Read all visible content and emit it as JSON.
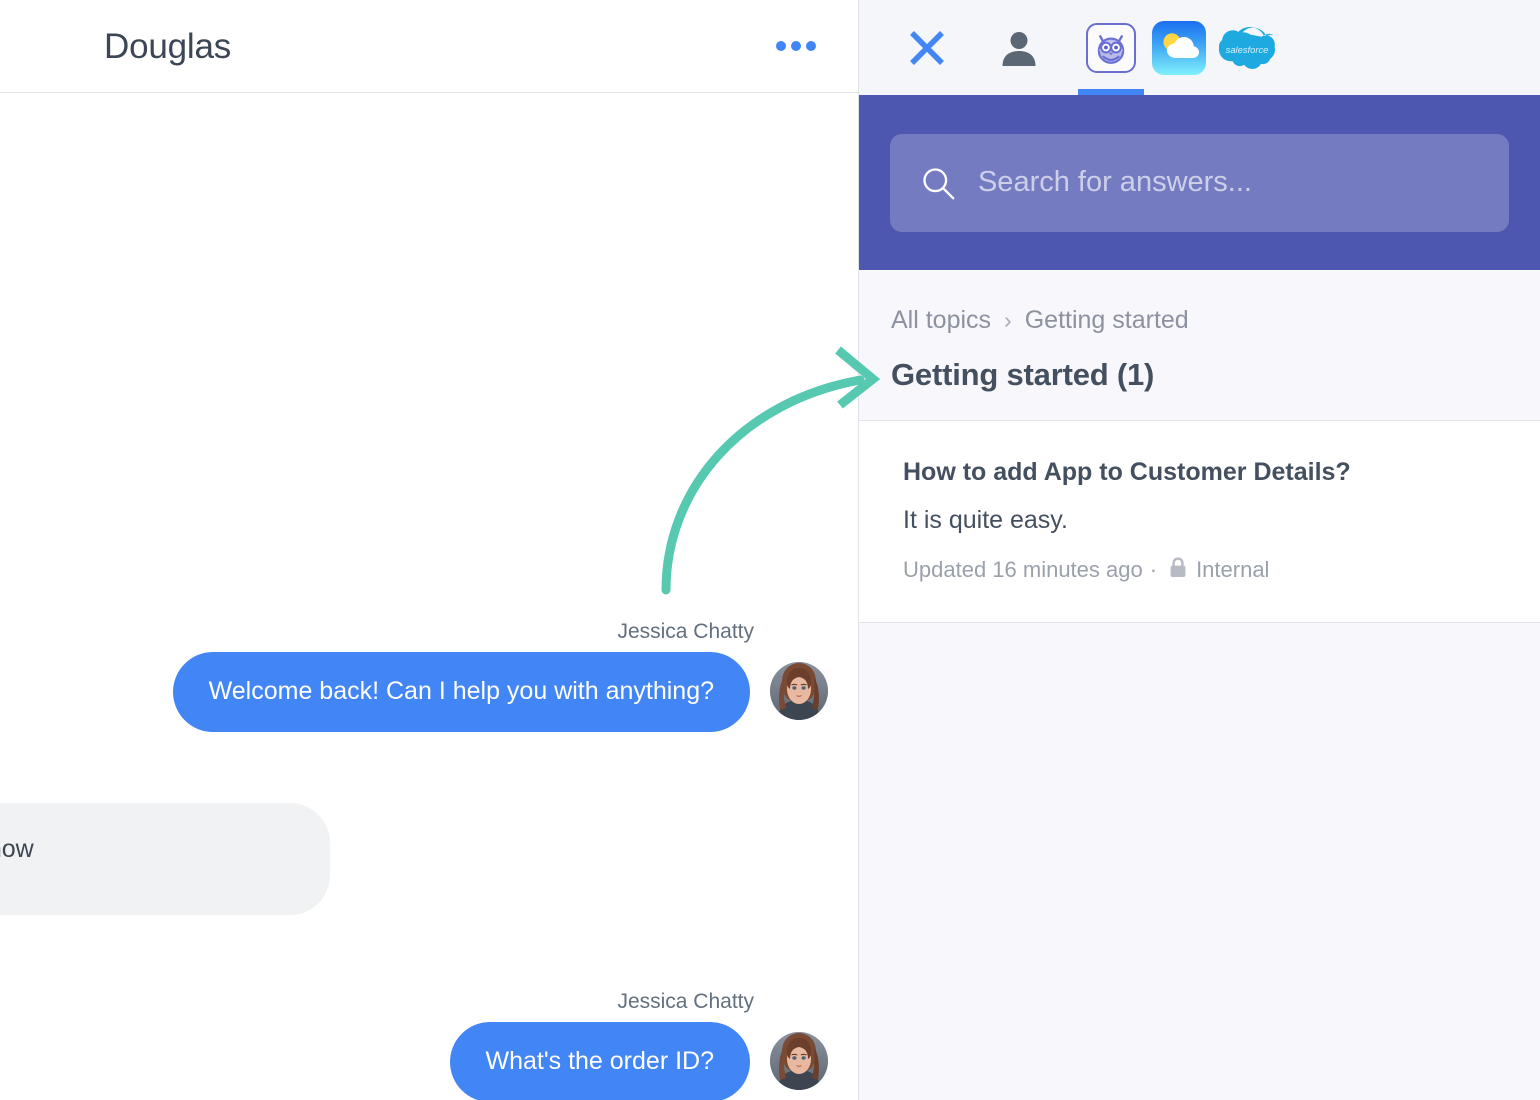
{
  "chat": {
    "title": "Douglas",
    "more_icon": "ellipsis-icon",
    "messages": [
      {
        "sender": "Jessica Chatty",
        "text": "Welcome back! Can I help you with anything?",
        "direction": "outgoing"
      },
      {
        "sender": "",
        "text": "se but I don't know",
        "direction": "incoming"
      },
      {
        "sender": "Jessica Chatty",
        "text": "What's the order ID?",
        "direction": "outgoing"
      }
    ]
  },
  "knowledge_panel": {
    "appbar": {
      "close_icon": "close-icon",
      "apps": [
        {
          "name": "contact-app",
          "icon": "person-icon",
          "active": false
        },
        {
          "name": "knowledge-owl-app",
          "icon": "owl-icon",
          "active": true
        },
        {
          "name": "weather-app",
          "icon": "weather-icon",
          "active": false
        },
        {
          "name": "salesforce-app",
          "icon": "salesforce-cloud-icon",
          "label": "salesforce",
          "active": false
        }
      ]
    },
    "search": {
      "placeholder": "Search for answers...",
      "value": "",
      "icon": "search-icon"
    },
    "breadcrumb": {
      "root": "All topics",
      "separator": "›",
      "current": "Getting started"
    },
    "topic_title": "Getting started (1)",
    "articles": [
      {
        "title": "How to add App to Customer Details?",
        "snippet": "It is quite easy.",
        "updated": "Updated 16 minutes ago",
        "separator": "·",
        "visibility": "Internal",
        "visibility_icon": "lock-icon"
      }
    ]
  },
  "annotation": {
    "arrow": "curved-arrow",
    "color": "#56c9b0"
  },
  "colors": {
    "accent_blue": "#4285f4",
    "search_purple": "#4d57b0",
    "panel_bg": "#f8f7fc",
    "appbar_bg": "#f4f6f9",
    "text_dark": "#44505f",
    "text_muted": "#9aa0ac",
    "arrow_green": "#56c9b0"
  }
}
